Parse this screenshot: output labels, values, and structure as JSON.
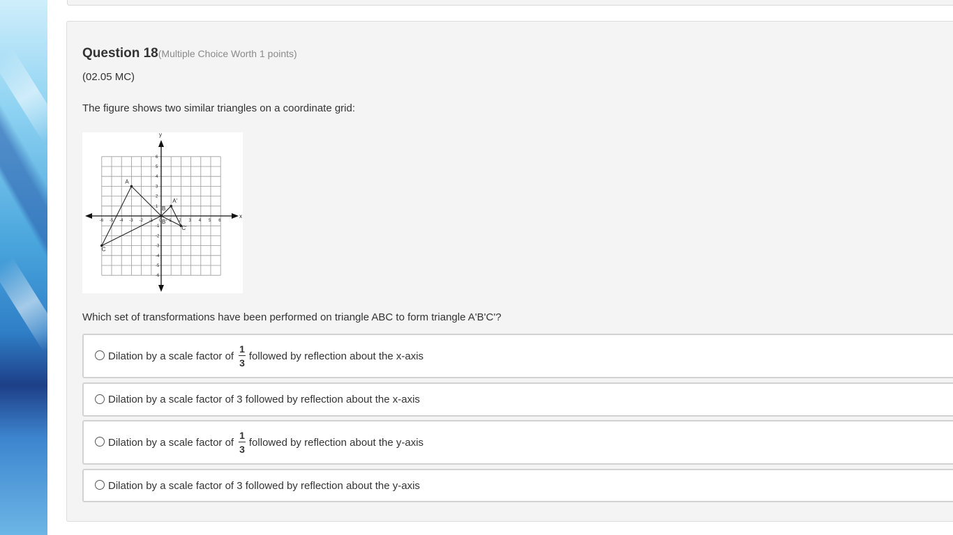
{
  "question": {
    "title": "Question 18",
    "meta": "(Multiple Choice Worth 1 points)",
    "code": "(02.05 MC)",
    "prompt": "The figure shows two similar triangles on a coordinate grid:",
    "ask": "Which set of transformations have been performed on triangle ABC to form triangle A'B'C'?"
  },
  "figure": {
    "axis_x_label": "x",
    "axis_y_label": "y",
    "x_ticks": [
      "-6",
      "-5",
      "-4",
      "-3",
      "-2",
      "-1",
      "0",
      "1",
      "2",
      "3",
      "4",
      "5",
      "6"
    ],
    "y_ticks": [
      "6",
      "5",
      "4",
      "3",
      "2",
      "1",
      "-1",
      "-2",
      "-3",
      "-4",
      "-5",
      "-6"
    ],
    "triangle_abc": [
      {
        "label": "A",
        "x": -3,
        "y": 3
      },
      {
        "label": "B",
        "x": 0,
        "y": 0
      },
      {
        "label": "C",
        "x": -6,
        "y": -3
      }
    ],
    "triangle_abc_prime": [
      {
        "label": "A'",
        "x": 1,
        "y": 1
      },
      {
        "label": "B'",
        "x": 0,
        "y": 0
      },
      {
        "label": "C'",
        "x": 2,
        "y": -1
      }
    ]
  },
  "options": [
    {
      "before": "Dilation by a scale factor of",
      "frac_num": "1",
      "frac_den": "3",
      "after": "followed by reflection about the x-axis"
    },
    {
      "before": "Dilation by a scale factor of 3 followed by reflection about the x-axis"
    },
    {
      "before": "Dilation by a scale factor of",
      "frac_num": "1",
      "frac_den": "3",
      "after": "followed by reflection about the y-axis"
    },
    {
      "before": "Dilation by a scale factor of 3 followed by reflection about the y-axis"
    }
  ]
}
